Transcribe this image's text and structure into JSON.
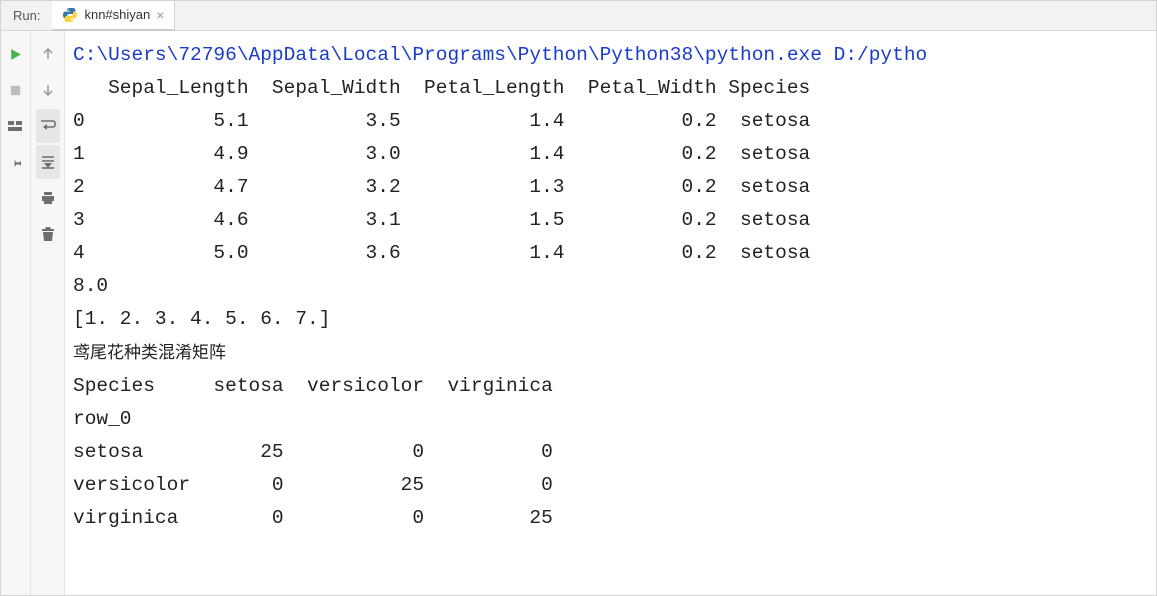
{
  "header": {
    "run_label": "Run:",
    "tab_name": "knn#shiyan"
  },
  "console": {
    "path_line": "C:\\Users\\72796\\AppData\\Local\\Programs\\Python\\Python38\\python.exe D:/pytho",
    "df_header": "   Sepal_Length  Sepal_Width  Petal_Length  Petal_Width Species",
    "df_rows": [
      "0           5.1          3.5           1.4          0.2  setosa",
      "1           4.9          3.0           1.4          0.2  setosa",
      "2           4.7          3.2           1.3          0.2  setosa",
      "3           4.6          3.1           1.5          0.2  setosa",
      "4           5.0          3.6           1.4          0.2  setosa"
    ],
    "val_line": "8.0",
    "arr_line": "[1. 2. 3. 4. 5. 6. 7.]",
    "cn_title": "鸢尾花种类混淆矩阵",
    "cm_header": "Species     setosa  versicolor  virginica",
    "cm_row0": "row_0",
    "cm_rows": [
      "setosa          25           0          0",
      "versicolor       0          25          0",
      "virginica        0           0         25"
    ]
  },
  "chart_data": {
    "type": "table",
    "title": "Iris dataframe head",
    "columns": [
      "Sepal_Length",
      "Sepal_Width",
      "Petal_Length",
      "Petal_Width",
      "Species"
    ],
    "rows": [
      [
        5.1,
        3.5,
        1.4,
        0.2,
        "setosa"
      ],
      [
        4.9,
        3.0,
        1.4,
        0.2,
        "setosa"
      ],
      [
        4.7,
        3.2,
        1.3,
        0.2,
        "setosa"
      ],
      [
        4.6,
        3.1,
        1.5,
        0.2,
        "setosa"
      ],
      [
        5.0,
        3.6,
        1.4,
        0.2,
        "setosa"
      ]
    ],
    "extra": {
      "scalar": 8.0,
      "array": [
        1,
        2,
        3,
        4,
        5,
        6,
        7
      ],
      "confusion_matrix": {
        "labels": [
          "setosa",
          "versicolor",
          "virginica"
        ],
        "matrix": [
          [
            25,
            0,
            0
          ],
          [
            0,
            25,
            0
          ],
          [
            0,
            0,
            25
          ]
        ]
      }
    }
  }
}
